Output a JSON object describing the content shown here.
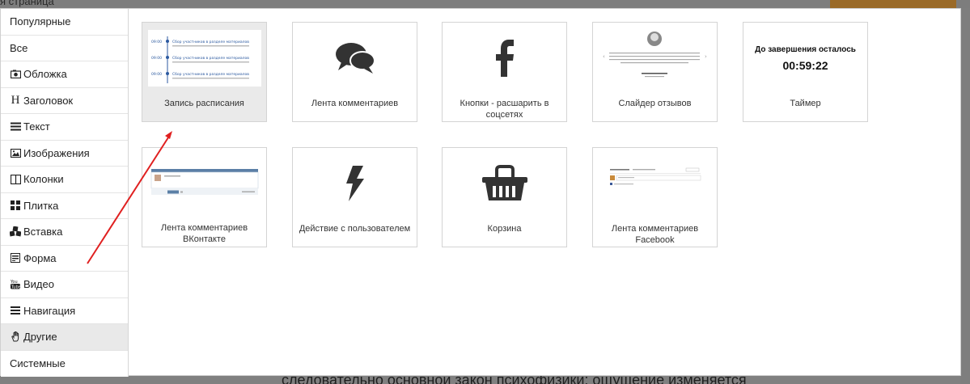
{
  "background": {
    "partial_title": "я страница",
    "partial_text": "следовательно основной закон психофизики: ощущение изменяется"
  },
  "sidebar": {
    "items": [
      {
        "label": "Популярные",
        "icon": "none"
      },
      {
        "label": "Все",
        "icon": "none"
      },
      {
        "label": "Обложка",
        "icon": "camera-icon"
      },
      {
        "label": "Заголовок",
        "icon": "heading-icon"
      },
      {
        "label": "Текст",
        "icon": "text-lines-icon"
      },
      {
        "label": "Изображения",
        "icon": "image-icon"
      },
      {
        "label": "Колонки",
        "icon": "columns-icon"
      },
      {
        "label": "Плитка",
        "icon": "tiles-icon"
      },
      {
        "label": "Вставка",
        "icon": "cubes-icon"
      },
      {
        "label": "Форма",
        "icon": "form-icon"
      },
      {
        "label": "Видео",
        "icon": "youtube-icon"
      },
      {
        "label": "Навигация",
        "icon": "menu-icon"
      },
      {
        "label": "Другие",
        "icon": "hand-icon"
      },
      {
        "label": "Системные",
        "icon": "none"
      }
    ],
    "active_index": 12
  },
  "blocks": [
    {
      "label": "Запись расписания",
      "thumb": "schedule-preview",
      "active": true
    },
    {
      "label": "Лента комментариев",
      "thumb": "comments-icon"
    },
    {
      "label": "Кнопки - расшарить в соцсетях",
      "thumb": "facebook-icon"
    },
    {
      "label": "Слайдер отзывов",
      "thumb": "reviews-preview"
    },
    {
      "label": "Таймер",
      "thumb": "timer-preview"
    },
    {
      "label": "Лента комментариев ВКонтакте",
      "thumb": "vk-comments-preview"
    },
    {
      "label": "Действие с пользователем",
      "thumb": "bolt-icon"
    },
    {
      "label": "Корзина",
      "thumb": "basket-icon"
    },
    {
      "label": "Лента комментариев Facebook",
      "thumb": "fb-comments-preview"
    }
  ],
  "timer": {
    "title": "До завершения осталось",
    "value": "00:59:22"
  },
  "schedule_preview": {
    "rows": [
      {
        "time": "09:00",
        "title": "Сбор участников в разделе материалов"
      },
      {
        "time": "09:00",
        "title": "Сбор участников в разделе материалов"
      },
      {
        "time": "09:00",
        "title": "Сбор участников в разделе материалов"
      }
    ]
  },
  "colors": {
    "accent_blue": "#2c5aa0",
    "arrow_red": "#e02020",
    "icon_dark": "#333333"
  }
}
